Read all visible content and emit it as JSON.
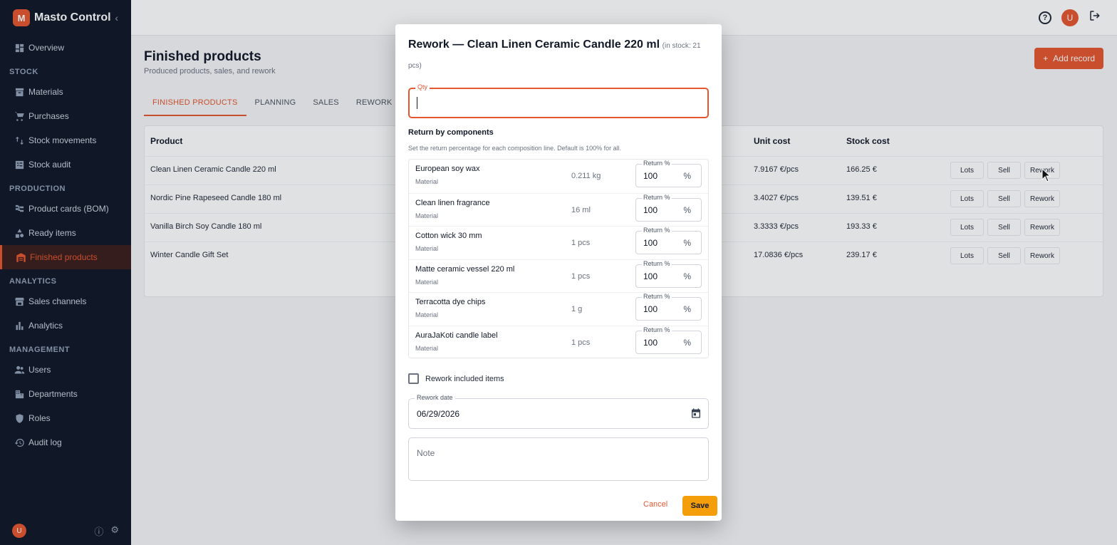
{
  "app": {
    "logo_letter": "M",
    "name": "Masto Control",
    "collapse": "‹"
  },
  "sidebar": {
    "top_items": [
      {
        "label": "Overview",
        "icon": "dashboard-icon"
      }
    ],
    "sections": [
      {
        "title": "STOCK",
        "items": [
          {
            "label": "Materials",
            "icon": "archive-icon"
          },
          {
            "label": "Purchases",
            "icon": "cart-icon"
          },
          {
            "label": "Stock movements",
            "icon": "swap-icon"
          },
          {
            "label": "Stock audit",
            "icon": "checklist-icon"
          }
        ]
      },
      {
        "title": "PRODUCTION",
        "items": [
          {
            "label": "Product cards (BOM)",
            "icon": "tree-icon"
          },
          {
            "label": "Ready items",
            "icon": "shapes-icon"
          },
          {
            "label": "Finished products",
            "icon": "warehouse-icon",
            "active": true
          }
        ]
      },
      {
        "title": "ANALYTICS",
        "items": [
          {
            "label": "Sales channels",
            "icon": "store-icon"
          },
          {
            "label": "Analytics",
            "icon": "bar-chart-icon"
          }
        ]
      },
      {
        "title": "MANAGEMENT",
        "items": [
          {
            "label": "Users",
            "icon": "users-icon"
          },
          {
            "label": "Departments",
            "icon": "building-icon"
          },
          {
            "label": "Roles",
            "icon": "shield-icon"
          },
          {
            "label": "Audit log",
            "icon": "history-icon"
          }
        ]
      }
    ],
    "footer_avatar": "U"
  },
  "topbar": {
    "help": "?",
    "avatar": "U"
  },
  "page": {
    "title": "Finished products",
    "subtitle": "Produced products, sales, and rework",
    "add_button": "Add record",
    "tabs": [
      "FINISHED PRODUCTS",
      "PLANNING",
      "SALES",
      "REWORK"
    ],
    "active_tab": 0,
    "table": {
      "headers": {
        "product": "Product",
        "unit_cost": "Unit cost",
        "stock_cost": "Stock cost"
      },
      "rows": [
        {
          "product": "Clean Linen Ceramic Candle 220 ml",
          "unit_cost": "7.9167 €/pcs",
          "stock_cost": "166.25 €"
        },
        {
          "product": "Nordic Pine Rapeseed Candle 180 ml",
          "unit_cost": "3.4027 €/pcs",
          "stock_cost": "139.51 €"
        },
        {
          "product": "Vanilla Birch Soy Candle 180 ml",
          "unit_cost": "3.3333 €/pcs",
          "stock_cost": "193.33 €"
        },
        {
          "product": "Winter Candle Gift Set",
          "unit_cost": "17.0836 €/pcs",
          "stock_cost": "239.17 €"
        }
      ],
      "actions": {
        "lots": "Lots",
        "sell": "Sell",
        "rework": "Rework"
      }
    }
  },
  "dialog": {
    "title": "Rework — Clean Linen Ceramic Candle 220 ml",
    "stock_note": "(in stock: 21 pcs)",
    "qty_label": "Qty",
    "qty_value": "",
    "components_title": "Return by components",
    "components_hint": "Set the return percentage for each composition line. Default is 100% for all.",
    "return_label": "Return %",
    "percent_sign": "%",
    "components": [
      {
        "name": "European soy wax",
        "type": "Material",
        "qty": "0.211 kg",
        "return": "100"
      },
      {
        "name": "Clean linen fragrance",
        "type": "Material",
        "qty": "16 ml",
        "return": "100"
      },
      {
        "name": "Cotton wick 30 mm",
        "type": "Material",
        "qty": "1 pcs",
        "return": "100"
      },
      {
        "name": "Matte ceramic vessel 220 ml",
        "type": "Material",
        "qty": "1 pcs",
        "return": "100"
      },
      {
        "name": "Terracotta dye chips",
        "type": "Material",
        "qty": "1 g",
        "return": "100"
      },
      {
        "name": "AuraJaKoti candle label",
        "type": "Material",
        "qty": "1 pcs",
        "return": "100"
      }
    ],
    "rework_included_label": "Rework included items",
    "rework_included_checked": false,
    "date_label": "Rework date",
    "date_value": "06/29/2026",
    "note_placeholder": "Note",
    "cancel": "Cancel",
    "save": "Save"
  },
  "colors": {
    "accent": "#e4572e",
    "save": "#f59e0b",
    "sidebar_bg": "#111827"
  }
}
